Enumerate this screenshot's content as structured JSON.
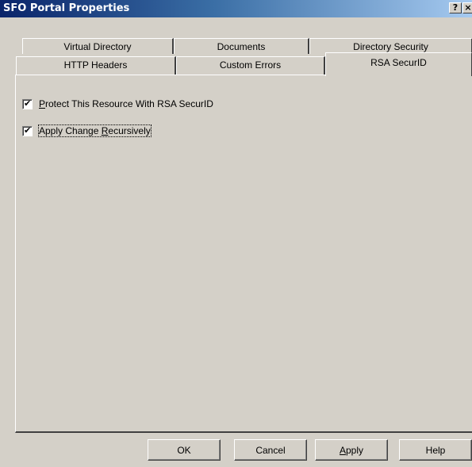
{
  "window": {
    "title": "SFO Portal Properties",
    "help_glyph": "?",
    "close_glyph": "×"
  },
  "tabs": {
    "row_back": [
      {
        "label": "Virtual Directory"
      },
      {
        "label": "Documents"
      },
      {
        "label": "Directory Security"
      }
    ],
    "row_front": [
      {
        "label": "HTTP Headers"
      },
      {
        "label": "Custom Errors"
      },
      {
        "label": "RSA SecurID",
        "active": true
      }
    ]
  },
  "options": {
    "protect": {
      "label_mnemonic": "P",
      "label_rest": "rotect This Resource With RSA SecurID",
      "checked": true,
      "check_glyph": "✔"
    },
    "recursive": {
      "label_before": "Apply Change ",
      "label_mnemonic": "R",
      "label_rest": "ecursively",
      "checked": true,
      "check_glyph": "✔"
    }
  },
  "buttons": {
    "ok": "OK",
    "cancel": "Cancel",
    "apply_mnemonic": "A",
    "apply_rest": "pply",
    "help": "Help"
  },
  "colors": {
    "title_gradient_start": "#0a246a",
    "title_gradient_end": "#a6caf0",
    "face": "#d4d0c8"
  }
}
